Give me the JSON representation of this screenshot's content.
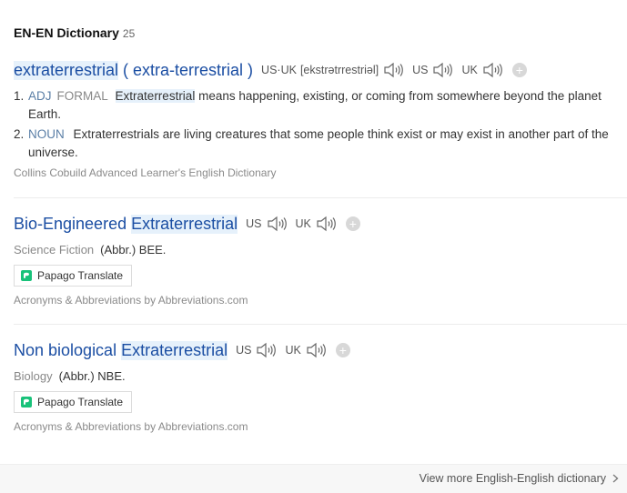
{
  "section": {
    "title": "EN-EN Dictionary",
    "count": "25"
  },
  "entries": [
    {
      "word": "extraterrestrial",
      "variant": "( extra-terrestrial )",
      "pron_label": "US·UK",
      "ipa": "[ekstrətrrestriəl]",
      "us_label": "US",
      "uk_label": "UK",
      "plus": "+",
      "defs": [
        {
          "num": "1.",
          "pos": "ADJ",
          "tag": "FORMAL",
          "keyword": "Extraterrestrial",
          "text": "means happening, existing, or coming from somewhere beyond the planet Earth."
        },
        {
          "num": "2.",
          "pos": "NOUN",
          "text": "Extraterrestrials are living creatures that some people think exist or may exist in another part of the universe."
        }
      ],
      "source": "Collins Cobuild Advanced Learner's English Dictionary"
    },
    {
      "word_a": "Bio-Engineered",
      "word_b": "Extraterrestrial",
      "us_label": "US",
      "uk_label": "UK",
      "plus": "+",
      "category": "Science Fiction",
      "abbr": "(Abbr.) BEE.",
      "translate": "Papago Translate",
      "source": "Acronyms & Abbreviations by Abbreviations.com"
    },
    {
      "word_a": "Non biological",
      "word_b": "Extraterrestrial",
      "us_label": "US",
      "uk_label": "UK",
      "plus": "+",
      "category": "Biology",
      "abbr": "(Abbr.) NBE.",
      "translate": "Papago Translate",
      "source": "Acronyms & Abbreviations by Abbreviations.com"
    }
  ],
  "footer": {
    "more": "View more English-English dictionary"
  },
  "icons": {
    "speaker": "speaker-icon",
    "plus": "plus-icon",
    "papago": "papago-icon",
    "chevron": "chevron-right-icon"
  },
  "colors": {
    "link": "#1b4ea3",
    "highlight": "#e6f1fb",
    "pos": "#5a7ea6",
    "papago_green": "#19c27a"
  }
}
